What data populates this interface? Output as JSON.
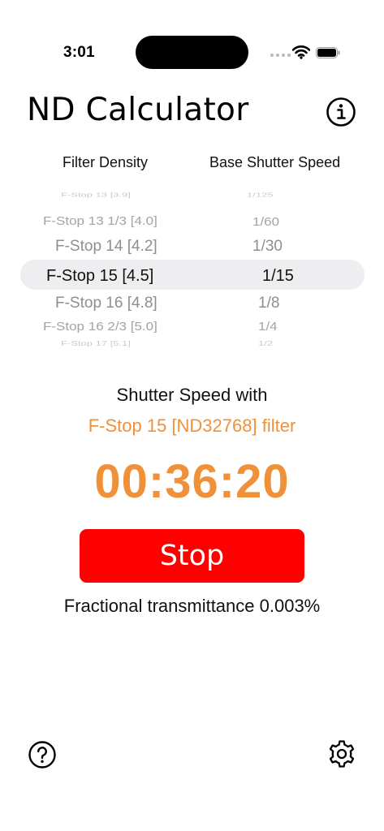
{
  "status_bar": {
    "time": "3:01",
    "icons": [
      "signal-icon",
      "wifi-icon",
      "battery-icon"
    ]
  },
  "header": {
    "title": "ND Calculator",
    "info_icon": "info-icon"
  },
  "picker": {
    "left_header": "Filter Density",
    "right_header": "Base Shutter Speed",
    "filter_items": [
      "F-Stop 13 [3.9]",
      "F-Stop 13 1/3 [4.0]",
      "F-Stop 14 [4.2]",
      "F-Stop 15 [4.5]",
      "F-Stop 16 [4.8]",
      "F-Stop 16 2/3 [5.0]",
      "F-Stop 17 [5.1]"
    ],
    "speed_items": [
      "1/125",
      "1/60",
      "1/30",
      "1/15",
      "1/8",
      "1/4",
      "1/2"
    ],
    "selected_filter": "F-Stop 15 [4.5]",
    "selected_speed": "1/15"
  },
  "result": {
    "label": "Shutter Speed with",
    "filter_text": "F-Stop 15 [ND32768] filter",
    "timer": "00:36:20",
    "stop_label": "Stop",
    "transmittance": "Fractional transmittance 0.003%"
  },
  "footer": {
    "help_icon": "question-icon",
    "settings_icon": "gear-icon"
  },
  "colors": {
    "accent": "#f0913a",
    "stop_button": "#ff0000",
    "picker_highlight": "#eeeef0",
    "picker_dim": "#8e8e93"
  }
}
